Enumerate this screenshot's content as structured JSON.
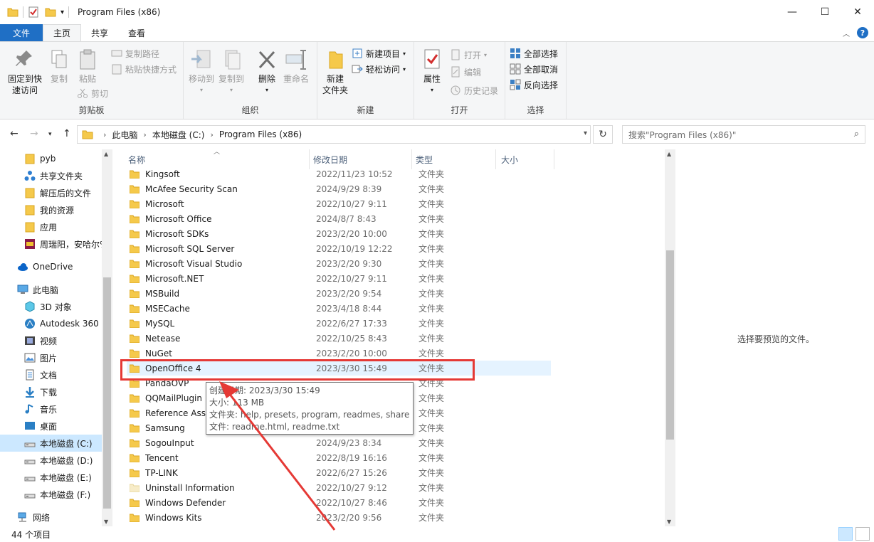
{
  "window": {
    "title": "Program Files (x86)"
  },
  "tabs": [
    {
      "label": "文件"
    },
    {
      "label": "主页"
    },
    {
      "label": "共享"
    },
    {
      "label": "查看"
    }
  ],
  "ribbon": {
    "clipboard": {
      "label": "剪贴板",
      "pin": "固定到快\n速访问",
      "copy": "复制",
      "paste": "粘贴",
      "copy_path": "复制路径",
      "paste_shortcut": "粘贴快捷方式",
      "cut": "剪切"
    },
    "organize": {
      "label": "组织",
      "move_to": "移动到",
      "copy_to": "复制到",
      "delete": "删除",
      "rename": "重命名"
    },
    "new": {
      "label": "新建",
      "new_folder": "新建\n文件夹",
      "new_item": "新建项目",
      "easy_access": "轻松访问"
    },
    "open": {
      "label": "打开",
      "properties": "属性",
      "open": "打开",
      "edit": "编辑",
      "history": "历史记录"
    },
    "select": {
      "label": "选择",
      "select_all": "全部选择",
      "select_none": "全部取消",
      "invert": "反向选择"
    }
  },
  "address": {
    "crumbs": [
      "此电脑",
      "本地磁盘 (C:)",
      "Program Files (x86)"
    ],
    "search_placeholder": "搜索\"Program Files (x86)\""
  },
  "sidebar": {
    "items": [
      {
        "label": "pyb",
        "icon": "folder-icon"
      },
      {
        "label": "共享文件夹",
        "icon": "share-icon"
      },
      {
        "label": "解压后的文件",
        "icon": "folder-icon"
      },
      {
        "label": "我的资源",
        "icon": "folder-icon"
      },
      {
        "label": "应用",
        "icon": "folder-icon"
      },
      {
        "label": "周瑞阳，安哈尔%",
        "icon": "archive-icon"
      },
      {
        "label": "OneDrive",
        "icon": "cloud-icon"
      },
      {
        "label": "此电脑",
        "icon": "computer-icon"
      },
      {
        "label": "3D 对象",
        "icon": "cube-icon"
      },
      {
        "label": "Autodesk 360",
        "icon": "autodesk-icon"
      },
      {
        "label": "视频",
        "icon": "video-icon"
      },
      {
        "label": "图片",
        "icon": "picture-icon"
      },
      {
        "label": "文档",
        "icon": "document-icon"
      },
      {
        "label": "下载",
        "icon": "download-icon"
      },
      {
        "label": "音乐",
        "icon": "music-icon"
      },
      {
        "label": "桌面",
        "icon": "desktop-icon"
      },
      {
        "label": "本地磁盘 (C:)",
        "icon": "drive-icon"
      },
      {
        "label": "本地磁盘 (D:)",
        "icon": "drive-icon"
      },
      {
        "label": "本地磁盘 (E:)",
        "icon": "drive-icon"
      },
      {
        "label": "本地磁盘 (F:)",
        "icon": "drive-icon"
      },
      {
        "label": "网络",
        "icon": "network-icon"
      }
    ]
  },
  "columns": {
    "name": "名称",
    "date": "修改日期",
    "type": "类型",
    "size": "大小"
  },
  "files": [
    {
      "name": "Kingsoft",
      "date": "2022/11/23 10:52",
      "type": "文件夹"
    },
    {
      "name": "McAfee Security Scan",
      "date": "2024/9/29 8:39",
      "type": "文件夹"
    },
    {
      "name": "Microsoft",
      "date": "2022/10/27 9:11",
      "type": "文件夹"
    },
    {
      "name": "Microsoft Office",
      "date": "2024/8/7 8:43",
      "type": "文件夹"
    },
    {
      "name": "Microsoft SDKs",
      "date": "2023/2/20 10:00",
      "type": "文件夹"
    },
    {
      "name": "Microsoft SQL Server",
      "date": "2022/10/19 12:22",
      "type": "文件夹"
    },
    {
      "name": "Microsoft Visual Studio",
      "date": "2023/2/20 9:30",
      "type": "文件夹"
    },
    {
      "name": "Microsoft.NET",
      "date": "2022/10/27 9:11",
      "type": "文件夹"
    },
    {
      "name": "MSBuild",
      "date": "2023/2/20 9:54",
      "type": "文件夹"
    },
    {
      "name": "MSECache",
      "date": "2023/4/18 8:44",
      "type": "文件夹"
    },
    {
      "name": "MySQL",
      "date": "2022/6/27 17:33",
      "type": "文件夹"
    },
    {
      "name": "Netease",
      "date": "2022/10/25 8:43",
      "type": "文件夹"
    },
    {
      "name": "NuGet",
      "date": "2023/2/20 10:00",
      "type": "文件夹"
    },
    {
      "name": "OpenOffice 4",
      "date": "2023/3/30 15:49",
      "type": "文件夹"
    },
    {
      "name": "PandaOVP",
      "date": "",
      "type": "文件夹"
    },
    {
      "name": "QQMailPlugin",
      "date": "",
      "type": "文件夹"
    },
    {
      "name": "Reference Asse",
      "date": "",
      "type": "文件夹"
    },
    {
      "name": "Samsung",
      "date": "",
      "type": "文件夹"
    },
    {
      "name": "SogouInput",
      "date": "2024/9/23 8:34",
      "type": "文件夹"
    },
    {
      "name": "Tencent",
      "date": "2022/8/19 16:16",
      "type": "文件夹"
    },
    {
      "name": "TP-LINK",
      "date": "2022/6/27 15:26",
      "type": "文件夹"
    },
    {
      "name": "Uninstall Information",
      "date": "2022/10/27 9:12",
      "type": "文件夹"
    },
    {
      "name": "Windows Defender",
      "date": "2022/10/27 8:46",
      "type": "文件夹"
    },
    {
      "name": "Windows Kits",
      "date": "2023/2/20 9:56",
      "type": "文件夹"
    }
  ],
  "tooltip": {
    "line1": "创建日期: 2023/3/30 15:49",
    "line2": "大小: 113 MB",
    "line3": "文件夹: help, presets, program, readmes, share",
    "line4": "文件: readme.html, readme.txt"
  },
  "preview": {
    "text": "选择要预览的文件。"
  },
  "status": {
    "count": "44 个项目"
  },
  "colors": {
    "accent": "#1f6fc5",
    "highlight": "#e53935",
    "selection": "#cce8ff",
    "hover": "#e5f3ff",
    "folder": "#f5c94b"
  }
}
